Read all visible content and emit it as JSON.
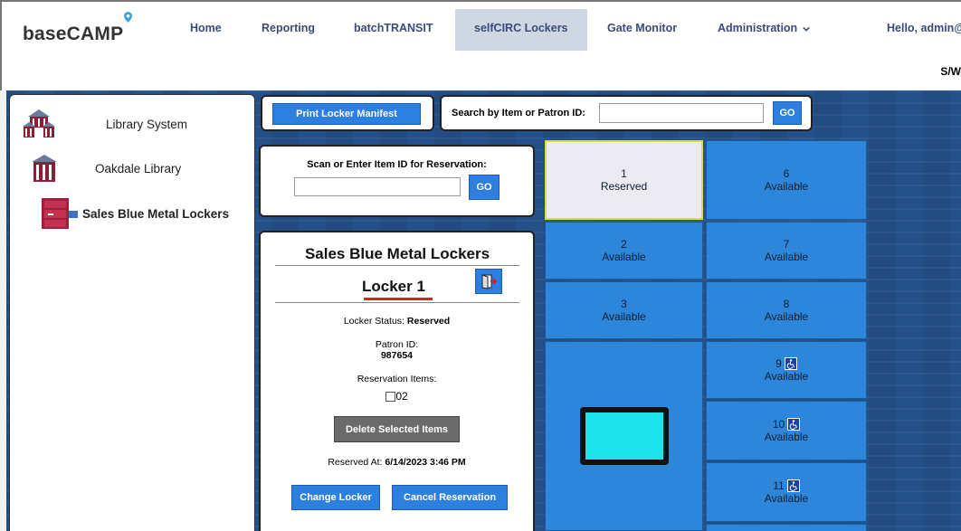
{
  "app": {
    "logo": "baseCAMP",
    "greeting": "Hello, admin@",
    "sub_right": "S/W"
  },
  "nav": [
    {
      "label": "Home"
    },
    {
      "label": "Reporting"
    },
    {
      "label": "batchTRANSIT"
    },
    {
      "label": "selfCIRC Lockers"
    },
    {
      "label": "Gate Monitor"
    },
    {
      "label": "Administration"
    }
  ],
  "tree": [
    {
      "label": "Library System",
      "icon": "library-building-icon"
    },
    {
      "label": "Oakdale Library",
      "icon": "library-building-icon"
    },
    {
      "label": "Sales Blue Metal Lockers",
      "icon": "locker-icon"
    }
  ],
  "toolbar": {
    "print_label": "Print Locker Manifest",
    "search_label": "Search by Item or Patron ID:",
    "search_value": "",
    "go_label": "GO"
  },
  "reservation_scan": {
    "label": "Scan or Enter Item ID for Reservation:",
    "value": "",
    "go_label": "GO"
  },
  "details": {
    "title": "Sales Blue Metal Lockers",
    "locker_name": "Locker 1",
    "status_label": "Locker Status:",
    "status_value": "Reserved",
    "patron_label": "Patron ID:",
    "patron_value": "987654",
    "items_label": "Reservation Items:",
    "item": "02",
    "delete_label": "Delete Selected Items",
    "reserved_at_label": "Reserved At:",
    "reserved_at_value": "6/14/2023 3:46 PM",
    "change_label": "Change Locker",
    "cancel_label": "Cancel Reservation"
  },
  "lockers": [
    {
      "num": "1",
      "status": "Reserved",
      "accessible": false,
      "selected": true
    },
    {
      "num": "2",
      "status": "Available",
      "accessible": false
    },
    {
      "num": "3",
      "status": "Available",
      "accessible": false
    },
    {
      "num": "6",
      "status": "Available",
      "accessible": false
    },
    {
      "num": "7",
      "status": "Available",
      "accessible": false
    },
    {
      "num": "8",
      "status": "Available",
      "accessible": false
    },
    {
      "num": "9",
      "status": "Available",
      "accessible": true
    },
    {
      "num": "10",
      "status": "Available",
      "accessible": true
    },
    {
      "num": "11",
      "status": "Available",
      "accessible": true
    }
  ],
  "colors": {
    "accent": "#2d7fe0",
    "panel_bg": "#24508a",
    "cell": "#2d86d9",
    "screen": "#1ee3ea",
    "selected": "#eceaf2"
  }
}
